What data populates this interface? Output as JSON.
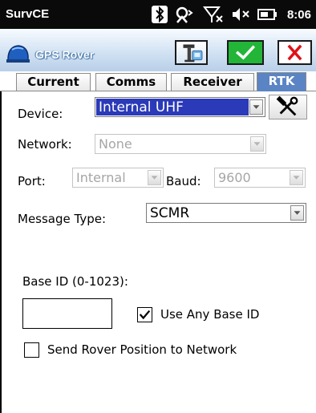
{
  "status_bar": {
    "app_name": "SurvCE",
    "time": "8:06",
    "icons": [
      "bluetooth-icon",
      "gps-signal-icon",
      "no-cellular-signal-icon",
      "volume-muted-icon",
      "battery-icon"
    ]
  },
  "title_bar": {
    "logo_icon": "gps-rover-helmet-icon",
    "title": "GPS Rover",
    "tools_button_icon": "survey-instrument-icon",
    "ok_button_icon": "checkmark-icon",
    "cancel_button_icon": "close-x-icon",
    "ok_color": "#22b538",
    "cancel_color": "#e0101a"
  },
  "tabs": [
    {
      "label": "Current",
      "active": false
    },
    {
      "label": "Comms",
      "active": false
    },
    {
      "label": "Receiver",
      "active": false
    },
    {
      "label": "RTK",
      "active": true
    }
  ],
  "form": {
    "device": {
      "label": "Device:",
      "value": "Internal UHF",
      "config_icon": "hammer-wrench-icon"
    },
    "network": {
      "label": "Network:",
      "value": "None",
      "enabled": false
    },
    "port": {
      "label": "Port:",
      "value": "Internal",
      "enabled": false
    },
    "baud": {
      "label": "Baud:",
      "value": "9600",
      "enabled": false
    },
    "message_type": {
      "label": "Message Type:",
      "value": "SCMR"
    },
    "base_id": {
      "label": "Base ID (0-1023):",
      "value": ""
    },
    "use_any_base_id": {
      "label": "Use Any Base ID",
      "checked": true
    },
    "send_rover_position": {
      "label": "Send Rover Position to Network",
      "checked": false
    }
  },
  "accent_color": "#5b84c4",
  "selection_color": "#2b3ab8"
}
